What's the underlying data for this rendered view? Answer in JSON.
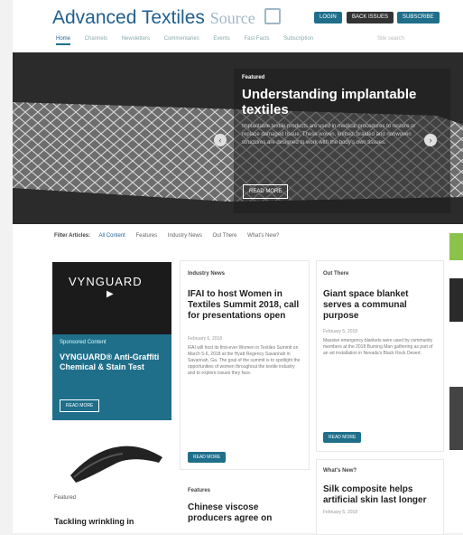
{
  "header": {
    "logo_main": "Advanced Textiles",
    "logo_source": "Source",
    "buttons": {
      "login": "LOGIN",
      "back_issues": "BACK ISSUES",
      "subscribe": "SUBSCRIBE"
    },
    "nav": [
      {
        "label": "Home",
        "active": true
      },
      {
        "label": "Channels",
        "active": false
      },
      {
        "label": "Newsletters",
        "active": false
      },
      {
        "label": "Commentaries",
        "active": false
      },
      {
        "label": "Events",
        "active": false
      },
      {
        "label": "Fast Facts",
        "active": false
      },
      {
        "label": "Subscription",
        "active": false
      }
    ],
    "search_placeholder": "Site search"
  },
  "hero": {
    "label": "Featured",
    "title": "Understanding implantable textiles",
    "excerpt": "Implantable textile products are used in medical procedures to restore or replace damaged tissue. These woven, knitted, braided and nonwoven structures are designed to work with the body’s own tissues.",
    "button": "READ MORE"
  },
  "filter": {
    "label": "Filter Articles:",
    "options": [
      {
        "label": "All Content",
        "active": true
      },
      {
        "label": "Features",
        "active": false
      },
      {
        "label": "Industry News",
        "active": false
      },
      {
        "label": "Out There",
        "active": false
      },
      {
        "label": "What’s New?",
        "active": false
      }
    ]
  },
  "ad": {
    "logo": "VYNGUARD",
    "sponsored": "Sponsored Content",
    "title": "VYNGUARD® Anti-Graffiti Chemical & Stain Test",
    "button": "READ MORE"
  },
  "featured_bottom": {
    "label": "Featured",
    "title": "Tackling wrinkling in"
  },
  "industry_news": {
    "label": "Industry News",
    "title": "IFAI to host Women in Textiles Summit 2018, call for presentations open",
    "date": "February 6, 2018",
    "excerpt": "IFAI will host its first-ever Women in Textiles Summit on March 5-6, 2018 at the Hyatt Regency Savannah in Savannah, Ga. The goal of the summit is to spotlight the opportunities of women throughout the textile industry and to explore issues they face.",
    "button": "READ MORE"
  },
  "features": {
    "label": "Features",
    "title": "Chinese viscose producers agree on"
  },
  "out_there": {
    "label": "Out There",
    "title": "Giant space blanket serves a communal purpose",
    "date": "February 5, 2018",
    "excerpt": "Massive emergency blankets were used by community members at the 2018 Burning Man gathering as part of an art installation in Nevada's Black Rock Desert.",
    "button": "READ MORE"
  },
  "whats_new": {
    "label": "What's New?",
    "title": "Silk composite helps artificial skin last longer",
    "date": "February 5, 2018"
  },
  "colors": {
    "brand": "#1f6f8b",
    "logo": "#1f5f8f",
    "hero_bg": "#2b2b2b"
  }
}
